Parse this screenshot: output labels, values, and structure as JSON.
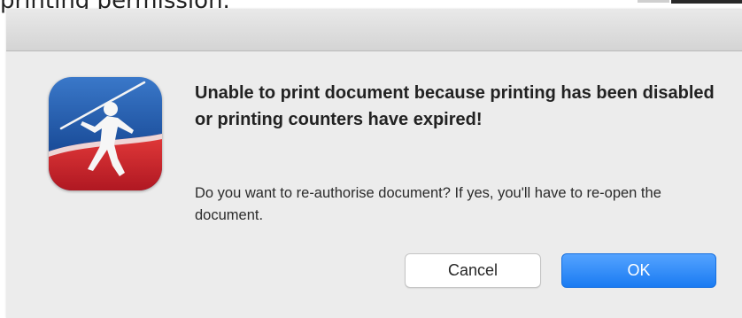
{
  "background": {
    "partial_text": "printing permission."
  },
  "dialog": {
    "headline": "Unable to print document because printing has been disabled or printing counters have expired!",
    "message": "Do you want to re-authorise document? If yes, you'll have to re-open the document.",
    "app_icon": "javelin-thrower-app-icon",
    "buttons": {
      "cancel_label": "Cancel",
      "ok_label": "OK"
    }
  },
  "colors": {
    "dialog_bg": "#ececec",
    "ok_button": "#1a7bf2",
    "icon_blue": "#1c4f9c",
    "icon_red": "#c8202c"
  }
}
